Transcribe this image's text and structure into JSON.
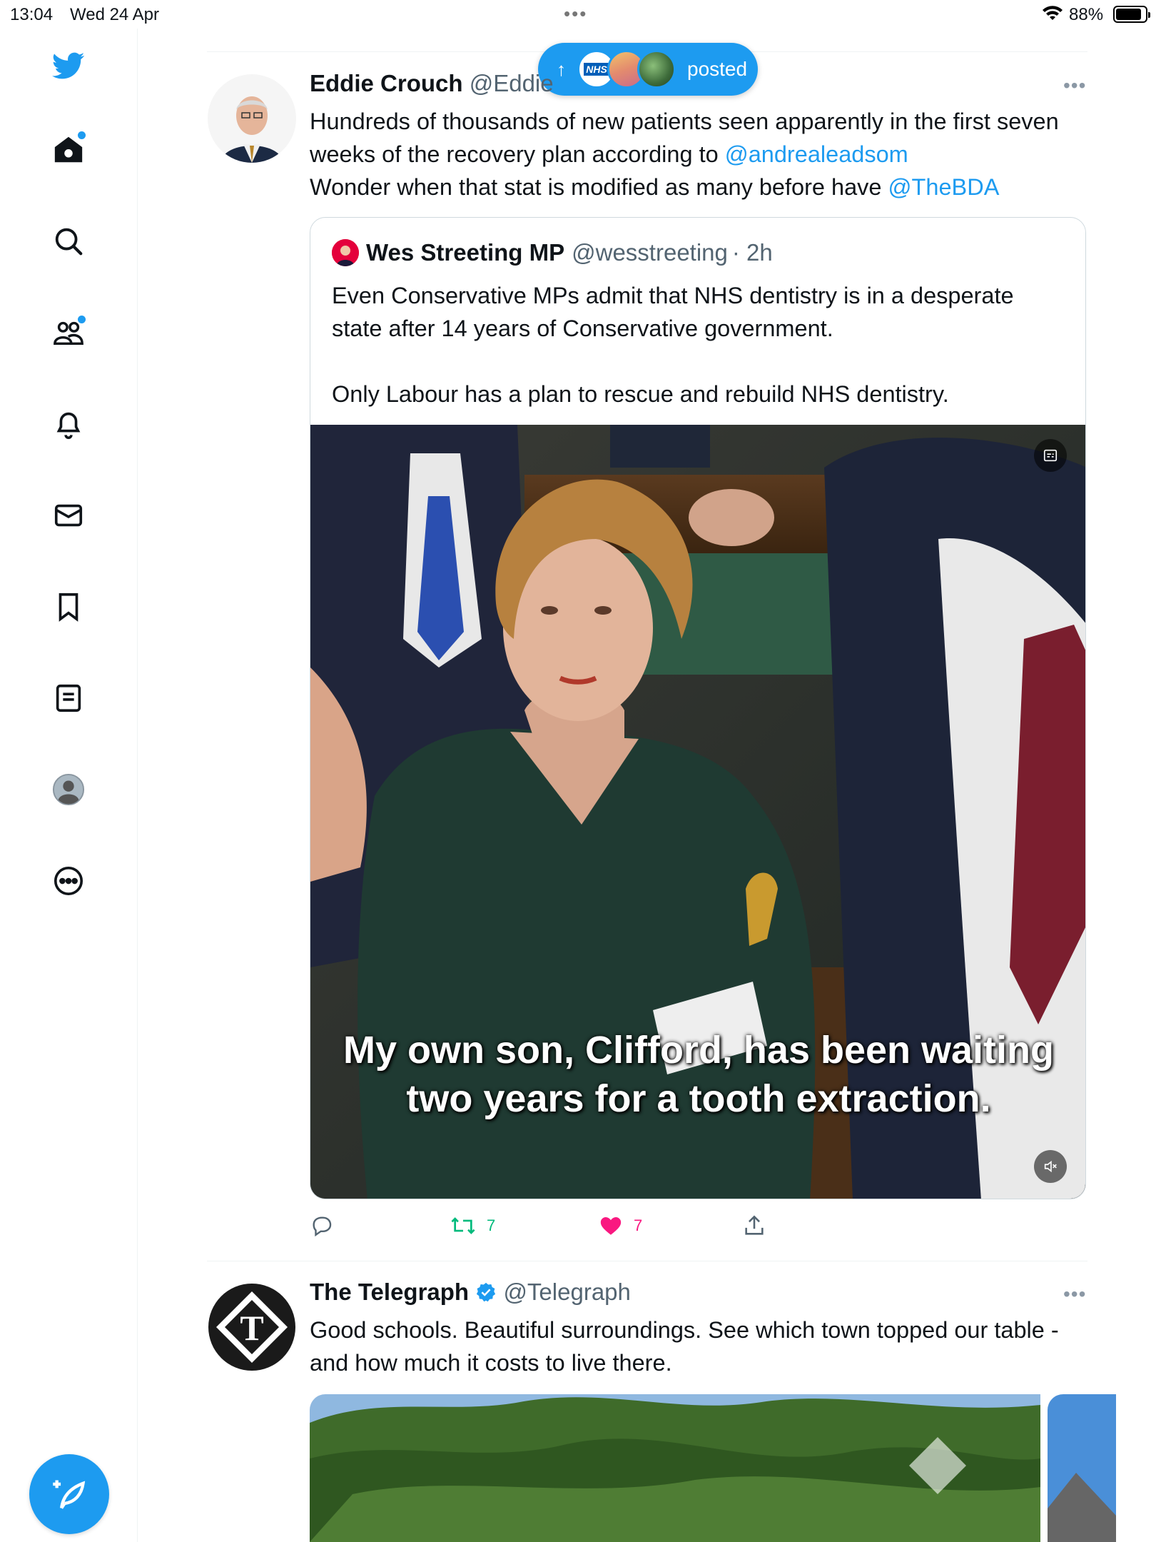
{
  "status_bar": {
    "time": "13:04",
    "date": "Wed 24 Apr",
    "battery": "88%"
  },
  "sidebar": {
    "items": [
      {
        "name": "twitter-logo-icon"
      },
      {
        "name": "home-icon"
      },
      {
        "name": "search-icon"
      },
      {
        "name": "communities-icon"
      },
      {
        "name": "notifications-icon"
      },
      {
        "name": "messages-icon"
      },
      {
        "name": "bookmarks-icon"
      },
      {
        "name": "lists-icon"
      },
      {
        "name": "profile-icon"
      },
      {
        "name": "more-icon"
      }
    ]
  },
  "new_posts_pill": {
    "label": "posted",
    "avatar_badge": "NHS"
  },
  "tweets": [
    {
      "author": "Eddie Crouch",
      "handle": "@Eddie",
      "text_1": "Hundreds of thousands of new patients seen apparently in the first seven weeks of the recovery plan according to ",
      "mention_1": "@andrealeadsom",
      "text_2": "Wonder when that stat is modified as many before have ",
      "mention_2": "@TheBDA",
      "quote": {
        "author": "Wes Streeting MP",
        "handle": "@wesstreeting",
        "time": "· 2h",
        "text_1": "Even Conservative MPs admit that NHS dentistry is in a desperate state after 14 years of Conservative government.",
        "text_2": "Only Labour has a plan to rescue and rebuild NHS dentistry.",
        "caption_1": "My own son, Clifford, has been waiting",
        "caption_2": "two years for a tooth extraction."
      },
      "retweets": "7",
      "likes": "7",
      "like_color": "#f91880",
      "retweet_color": "#00ba7c"
    },
    {
      "author": "The Telegraph",
      "handle": "@Telegraph",
      "verified": true,
      "text": "Good schools. Beautiful surroundings. See which town topped our table - and how much it costs to live there."
    }
  ],
  "colors": {
    "accent": "#1d9bf0",
    "text": "#0f1419",
    "secondary": "#536471"
  }
}
